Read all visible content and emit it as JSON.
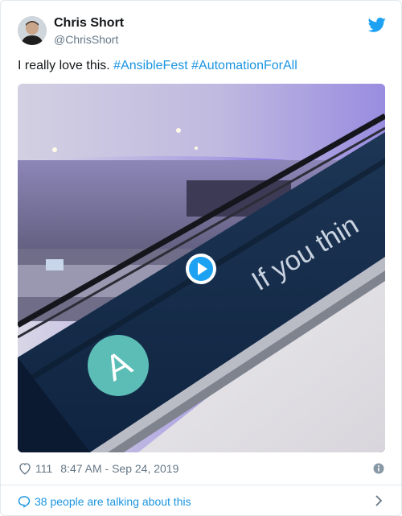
{
  "author": {
    "name": "Chris Short",
    "handle": "@ChrisShort"
  },
  "tweet": {
    "text": "I really love this.",
    "hashtags": [
      "#AnsibleFest",
      "#AutomationForAll"
    ]
  },
  "media": {
    "type": "video-gif",
    "overlay_text": "If you thin",
    "logo_letter": "A",
    "play_icon": "play-icon"
  },
  "meta": {
    "likes": "111",
    "timestamp": "8:47 AM - Sep 24, 2019"
  },
  "footer": {
    "talking_label": "38 people are talking about this"
  },
  "icons": {
    "brand": "twitter-bird-icon",
    "like": "heart-icon",
    "info": "info-icon",
    "reply": "speech-bubble-icon",
    "chevron": "chevron-right-icon"
  },
  "colors": {
    "accent": "#1b95e0",
    "secondary_text": "#657786",
    "ansible_teal": "#5bbdb6"
  }
}
